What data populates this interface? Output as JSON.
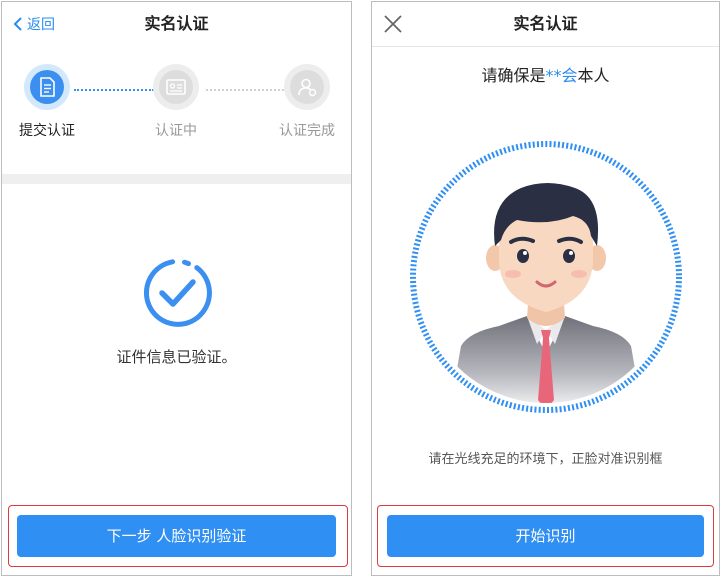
{
  "screen1": {
    "nav": {
      "back_label": "返回",
      "title": "实名认证"
    },
    "steps": [
      {
        "label": "提交认证",
        "state": "active"
      },
      {
        "label": "认证中",
        "state": "pending"
      },
      {
        "label": "认证完成",
        "state": "pending"
      }
    ],
    "status_text": "证件信息已验证。",
    "next_button_label": "下一步 人脸识别验证"
  },
  "screen2": {
    "nav": {
      "title": "实名认证"
    },
    "confirm": {
      "prefix": "请确保是",
      "name": "**会",
      "suffix": "本人"
    },
    "hint": "请在光线充足的环境下，正脸对准识别框",
    "start_button_label": "开始识别"
  },
  "colors": {
    "accent": "#2f8ff3",
    "highlight": "#e0393e"
  }
}
